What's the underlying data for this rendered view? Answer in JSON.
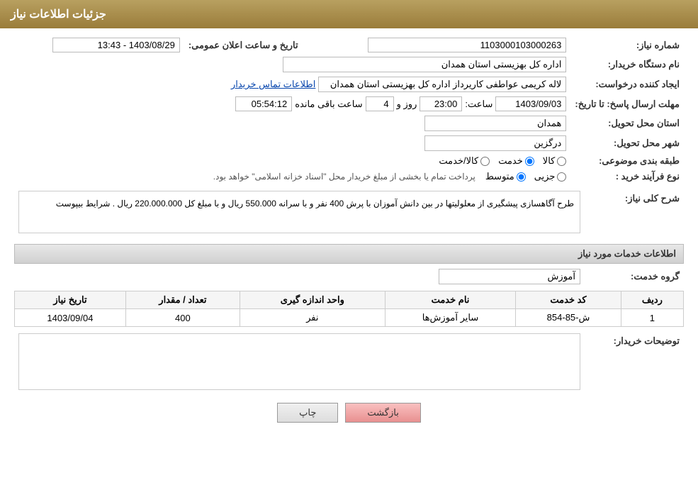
{
  "header": {
    "title": "جزئیات اطلاعات نیاز"
  },
  "fields": {
    "need_number_label": "شماره نیاز:",
    "need_number_value": "1103000103000263",
    "buyer_org_label": "نام دستگاه خریدار:",
    "buyer_org_value": "اداره کل بهزیستی استان همدان",
    "creator_label": "ایجاد کننده درخواست:",
    "creator_value": "لاله کریمی عواطفی کاریرداز اداره کل بهزیستی استان همدان",
    "creator_link": "اطلاعات تماس خریدار",
    "send_deadline_label": "مهلت ارسال پاسخ: تا تاریخ:",
    "deadline_date": "1403/09/03",
    "deadline_time_label": "ساعت:",
    "deadline_time": "23:00",
    "deadline_days_label": "روز و",
    "deadline_days": "4",
    "remaining_label": "ساعت باقی مانده",
    "remaining_time": "05:54:12",
    "province_label": "استان محل تحویل:",
    "province_value": "همدان",
    "city_label": "شهر محل تحویل:",
    "city_value": "درگزین",
    "category_label": "طبقه بندی موضوعی:",
    "category_options": [
      "کالا",
      "خدمت",
      "کالا/خدمت"
    ],
    "category_selected": "خدمت",
    "process_label": "نوع فرآیند خرید :",
    "process_options": [
      "جزیی",
      "متوسط"
    ],
    "process_selected": "متوسط",
    "process_note": "پرداخت تمام یا بخشی از مبلغ خریدار محل \"اسناد خزانه اسلامی\" خواهد بود.",
    "announce_date_label": "تاریخ و ساعت اعلان عمومی:",
    "announce_date_value": "1403/08/29 - 13:43",
    "description_label": "شرح کلی نیاز:",
    "description_text": "طرح آگاهسازی پیشگیری از معلولیتها در بین دانش آموزان با پرش 400 نفر و با سرانه 550.000 ریال و با مبلغ کل 220.000.000 ریال .  شرایط بیپوست",
    "services_section": "اطلاعات خدمات مورد نیاز",
    "service_group_label": "گروه خدمت:",
    "service_group_value": "آموزش",
    "table_headers": {
      "row": "ردیف",
      "code": "کد خدمت",
      "name": "نام خدمت",
      "unit": "واحد اندازه گیری",
      "count": "تعداد / مقدار",
      "date": "تاریخ نیاز"
    },
    "table_rows": [
      {
        "row": "1",
        "code": "ش-85-854",
        "name": "سایر آموزش‌ها",
        "unit": "نفر",
        "count": "400",
        "date": "1403/09/04"
      }
    ],
    "buyer_notes_label": "توضیحات خریدار:"
  },
  "buttons": {
    "return_label": "بازگشت",
    "print_label": "چاپ"
  }
}
